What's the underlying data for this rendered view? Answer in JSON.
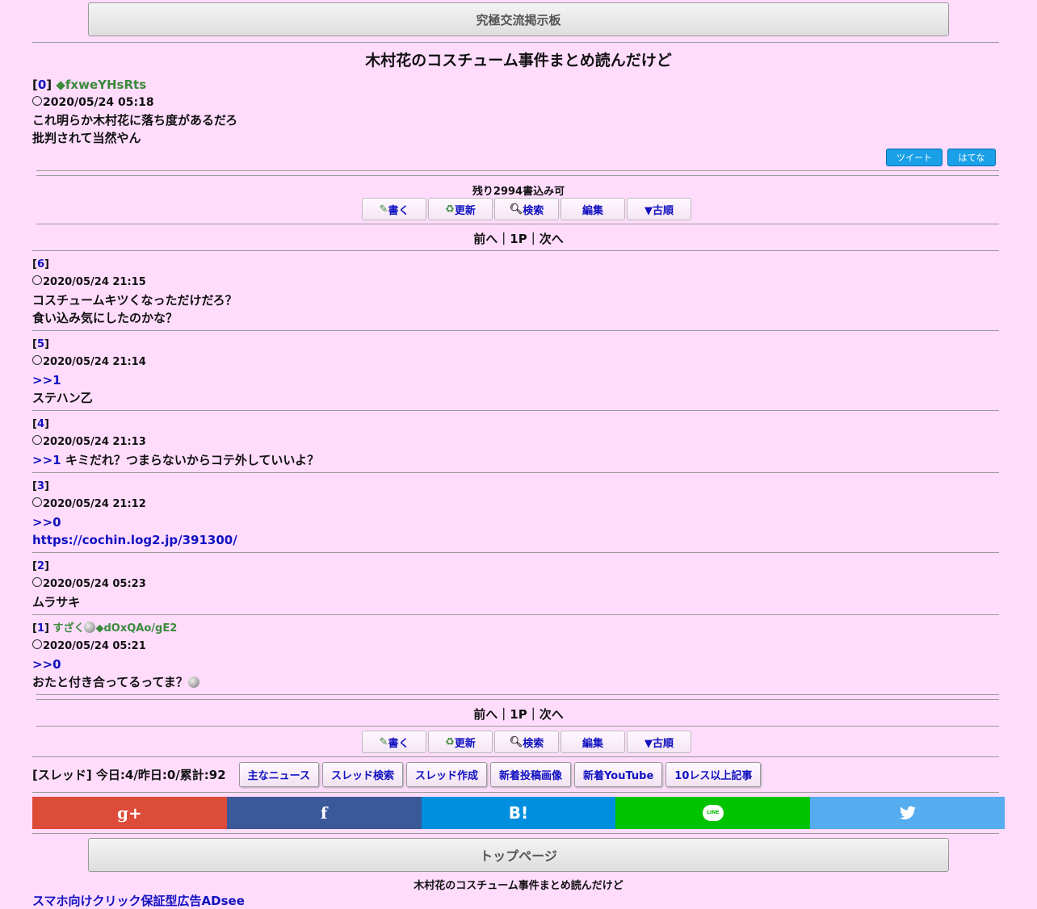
{
  "header": {
    "board_title": "究極交流掲示板"
  },
  "thread": {
    "title": "木村花のコスチューム事件まとめ読んだけど",
    "op": {
      "num": "0",
      "author": "◆fxweYHsRts",
      "date": "2020/05/24 05:18",
      "body1": "これ明らか木村花に落ち度があるだろ",
      "body2": "批判されて当然やん"
    },
    "share_tweet": "ツイート",
    "share_hatena": "はてな",
    "remaining": "残り2994書込み可"
  },
  "toolbar": {
    "write": "書く",
    "refresh": "更新",
    "search": "検索",
    "edit": "編集",
    "order": "▼古順"
  },
  "pager": {
    "prev": "前へ",
    "sep": "｜",
    "page": "1P",
    "next": "次へ"
  },
  "posts": {
    "p6": {
      "num": "6",
      "date": "2020/05/24 21:15",
      "body1": "コスチュームキツくなっただけだろ？",
      "body2": "食い込み気にしたのかな？"
    },
    "p5": {
      "num": "5",
      "date": "2020/05/24 21:14",
      "anchor": ">>1",
      "body": "ステハン乙"
    },
    "p4": {
      "num": "4",
      "date": "2020/05/24 21:13",
      "anchor": ">>1",
      "body": "キミだれ？つまらないからコテ外していいよ？"
    },
    "p3": {
      "num": "3",
      "date": "2020/05/24 21:12",
      "anchor": ">>0",
      "link": "https://cochin.log2.jp/391300/"
    },
    "p2": {
      "num": "2",
      "date": "2020/05/24 05:23",
      "body": "ムラサキ"
    },
    "p1": {
      "num": "1",
      "name": "すざく",
      "trip": "◆dOxQAo/gE2",
      "date": "2020/05/24 05:21",
      "anchor": ">>0",
      "body": "おたと付き合ってるってま？"
    }
  },
  "footer": {
    "stats": "[スレッド] 今日:4/昨日:0/累計:92",
    "nav": [
      "主なニュース",
      "スレッド検索",
      "スレッド作成",
      "新着投稿画像",
      "新着YouTube",
      "10レス以上記事"
    ],
    "top_page": "トップページ",
    "thread_title": "木村花のコスチューム事件まとめ読んだけど",
    "ad_link": "スマホ向けクリック保証型広告ADsee"
  },
  "social": {
    "gplus": "g+",
    "facebook": "f",
    "hatena": "B!",
    "line": "LINE",
    "twitter": "twitter",
    "colors": {
      "gplus": "#dd4b39",
      "facebook": "#3b5998",
      "hatena": "#008fde",
      "line": "#00c300",
      "twitter": "#55acee"
    }
  }
}
